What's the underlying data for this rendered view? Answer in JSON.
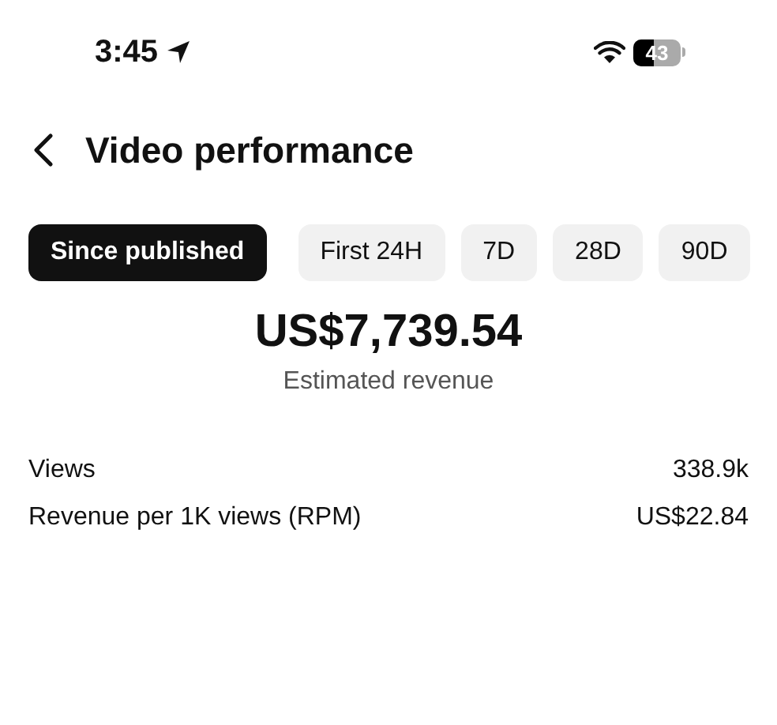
{
  "status_bar": {
    "time": "3:45",
    "battery": "43"
  },
  "header": {
    "title": "Video performance"
  },
  "ranges": [
    {
      "label": "Since published",
      "selected": true
    },
    {
      "label": "First 24H",
      "selected": false
    },
    {
      "label": "7D",
      "selected": false
    },
    {
      "label": "28D",
      "selected": false
    },
    {
      "label": "90D",
      "selected": false
    }
  ],
  "summary": {
    "value": "US$7,739.54",
    "label": "Estimated revenue"
  },
  "metrics": [
    {
      "label": "Views",
      "value": "338.9k"
    },
    {
      "label": "Revenue per 1K views (RPM)",
      "value": "US$22.84"
    }
  ]
}
